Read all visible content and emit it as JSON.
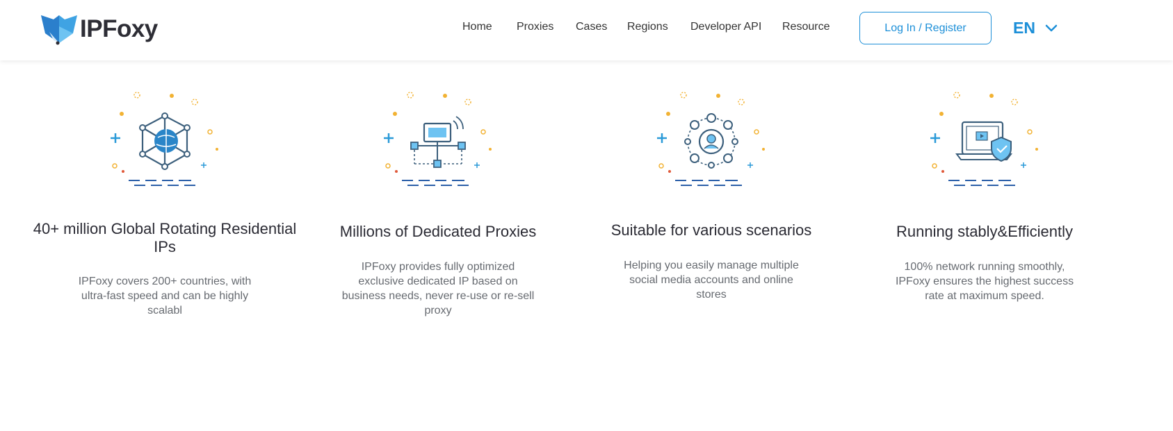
{
  "brand": {
    "name": "IPFoxy",
    "accent_color": "#1c8fd8",
    "logo_icon": "fox-logo-icon"
  },
  "nav": {
    "items": [
      "Home",
      "Proxies",
      "Cases",
      "Regions",
      "Developer API",
      "Resource"
    ]
  },
  "header": {
    "login_label": "Log In / Register",
    "language": "EN",
    "language_icon": "chevron-down-icon"
  },
  "features": [
    {
      "icon": "global-network-icon",
      "title": "40+ million Global Rotating Residential IPs",
      "description": "IPFoxy covers 200+ countries, with ultra-fast speed and can be highly scalabl"
    },
    {
      "icon": "dedicated-proxy-network-icon",
      "title": "Millions of Dedicated Proxies",
      "description": "IPFoxy provides fully optimized exclusive dedicated IP based on business needs, never re-use or re-sell proxy"
    },
    {
      "icon": "social-accounts-icon",
      "title": "Suitable for various scenarios",
      "description": "Helping you easily manage multiple social media accounts and online stores"
    },
    {
      "icon": "secure-laptop-icon",
      "title": "Running stably&Efficiently",
      "description": "100% network running smoothly, IPFoxy ensures the highest success rate at maximum speed."
    }
  ]
}
